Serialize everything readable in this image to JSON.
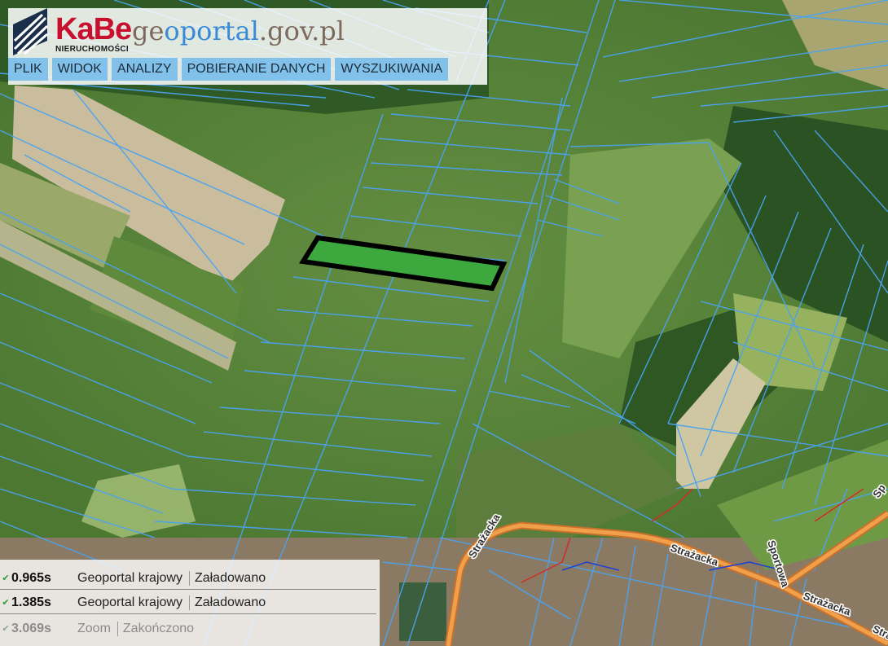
{
  "brand": {
    "logo_text": "KaBe",
    "logo_subtext": "NIERUCHOMOŚCI",
    "site_prefix": "ge",
    "site_mid": "oportal",
    "site_suffix": ".gov.pl"
  },
  "menu": [
    {
      "label": "PLIK"
    },
    {
      "label": "WIDOK"
    },
    {
      "label": "ANALIZY"
    },
    {
      "label": "POBIERANIE DANYCH"
    },
    {
      "label": "WYSZUKIWANIA"
    }
  ],
  "map": {
    "street_labels": [
      "Strażacka",
      "Strażacka",
      "Sportowa",
      "Strażacka",
      "Strażacka",
      "Sp"
    ],
    "colors": {
      "parcel_lines": "#4aa3f0",
      "highlight_fill": "#3da83d",
      "highlight_border": "#000000",
      "road": "#e8913a"
    }
  },
  "status": [
    {
      "time": "0.965s",
      "service": "Geoportal krajowy",
      "state": "Załadowano"
    },
    {
      "time": "1.385s",
      "service": "Geoportal krajowy",
      "state": "Załadowano"
    },
    {
      "time": "3.069s",
      "service": "Zoom",
      "state": "Zakończono"
    }
  ]
}
